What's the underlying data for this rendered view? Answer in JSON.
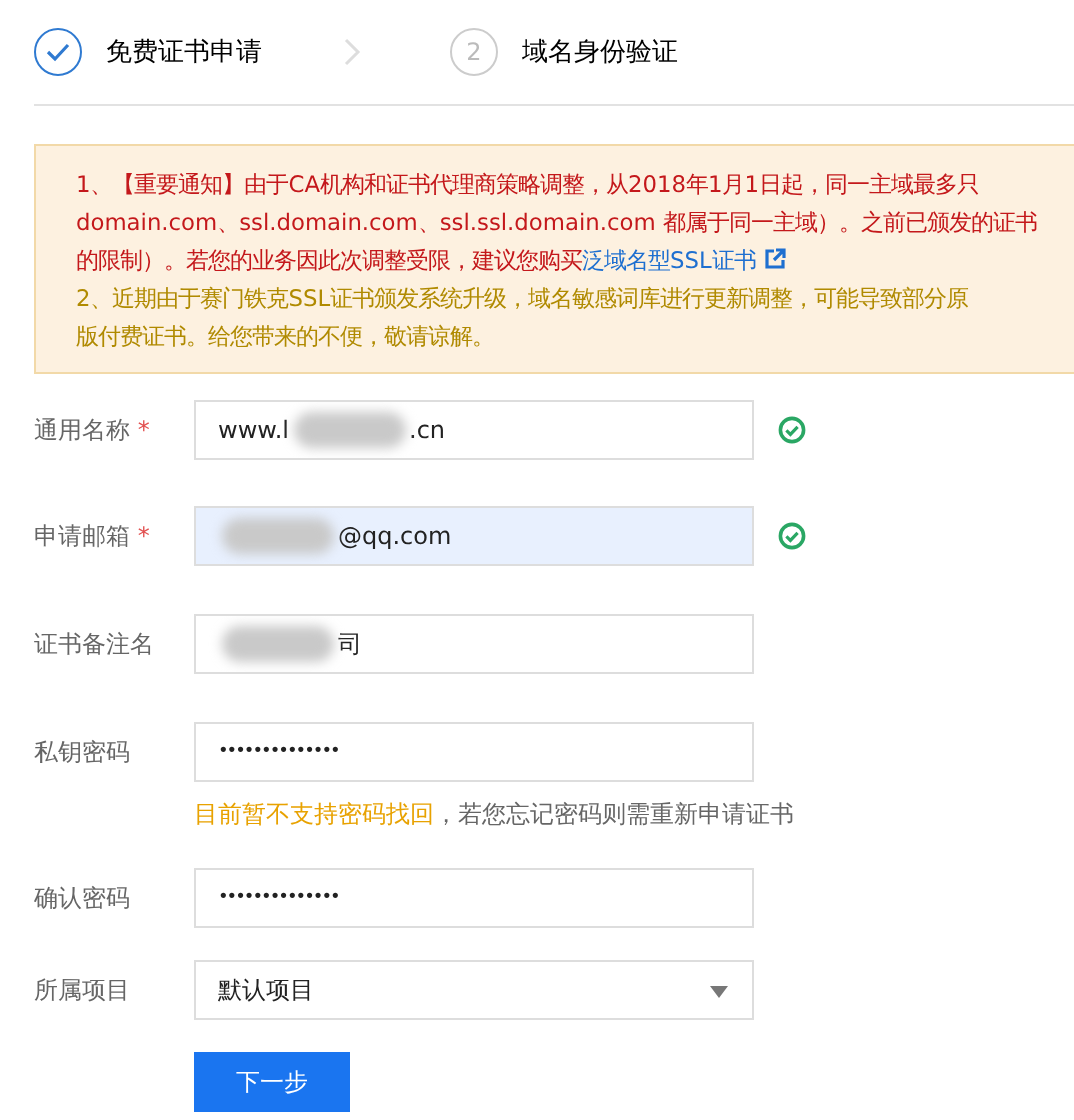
{
  "steps": [
    {
      "label": "免费证书申请",
      "done": true
    },
    {
      "label": "域名身份验证",
      "number": "2",
      "done": false
    }
  ],
  "notice": {
    "lines": [
      {
        "kind": "important",
        "text": "1、【重要通知】由于CA机构和证书代理商策略调整，从2018年1月1日起，同一主域最多只"
      },
      {
        "kind": "important",
        "text": "domain.com、ssl.domain.com、ssl.ssl.domain.com 都属于同一主域）。之前已颁发的证书"
      },
      {
        "kind": "important",
        "text": "的限制）。若您的业务因此次调整受限，建议您购买",
        "link": "泛域名型SSL证书"
      },
      {
        "kind": "normal",
        "text": "2、近期由于赛门铁克SSL证书颁发系统升级，域名敏感词库进行更新调整，可能导致部分原"
      },
      {
        "kind": "normal",
        "text": "版付费证书。给您带来的不便，敬请谅解。"
      }
    ]
  },
  "fields": [
    {
      "label": "通用名称",
      "required_mark": "*",
      "kind": "text",
      "valid": true,
      "autofilled": false,
      "segments": [
        {
          "kind": "text",
          "text": "www.l"
        },
        {
          "kind": "redacted"
        },
        {
          "kind": "text",
          "text": ".cn"
        }
      ]
    },
    {
      "label": "申请邮箱",
      "required_mark": "*",
      "kind": "text",
      "valid": true,
      "autofilled": true,
      "segments": [
        {
          "kind": "redacted"
        },
        {
          "kind": "text",
          "text": "@qq.com"
        }
      ]
    },
    {
      "label": "证书备注名",
      "kind": "text",
      "valid": false,
      "autofilled": false,
      "segments": [
        {
          "kind": "redacted"
        },
        {
          "kind": "text",
          "text": "司"
        }
      ]
    },
    {
      "label": "私钥密码",
      "kind": "password",
      "valid": false,
      "autofilled": false,
      "segments": [
        {
          "kind": "text",
          "text": "••••••••••••••"
        }
      ],
      "hint": {
        "warning": "目前暂不支持密码找回",
        "text": "，若您忘记密码则需重新申请证书"
      }
    },
    {
      "label": "确认密码",
      "kind": "password",
      "valid": false,
      "autofilled": false,
      "segments": [
        {
          "kind": "text",
          "text": "••••••••••••••"
        }
      ]
    },
    {
      "label": "所属项目",
      "kind": "select",
      "valid": false,
      "autofilled": false,
      "segments": [
        {
          "kind": "text",
          "text": "默认项目"
        }
      ]
    }
  ],
  "submit": "下一步"
}
